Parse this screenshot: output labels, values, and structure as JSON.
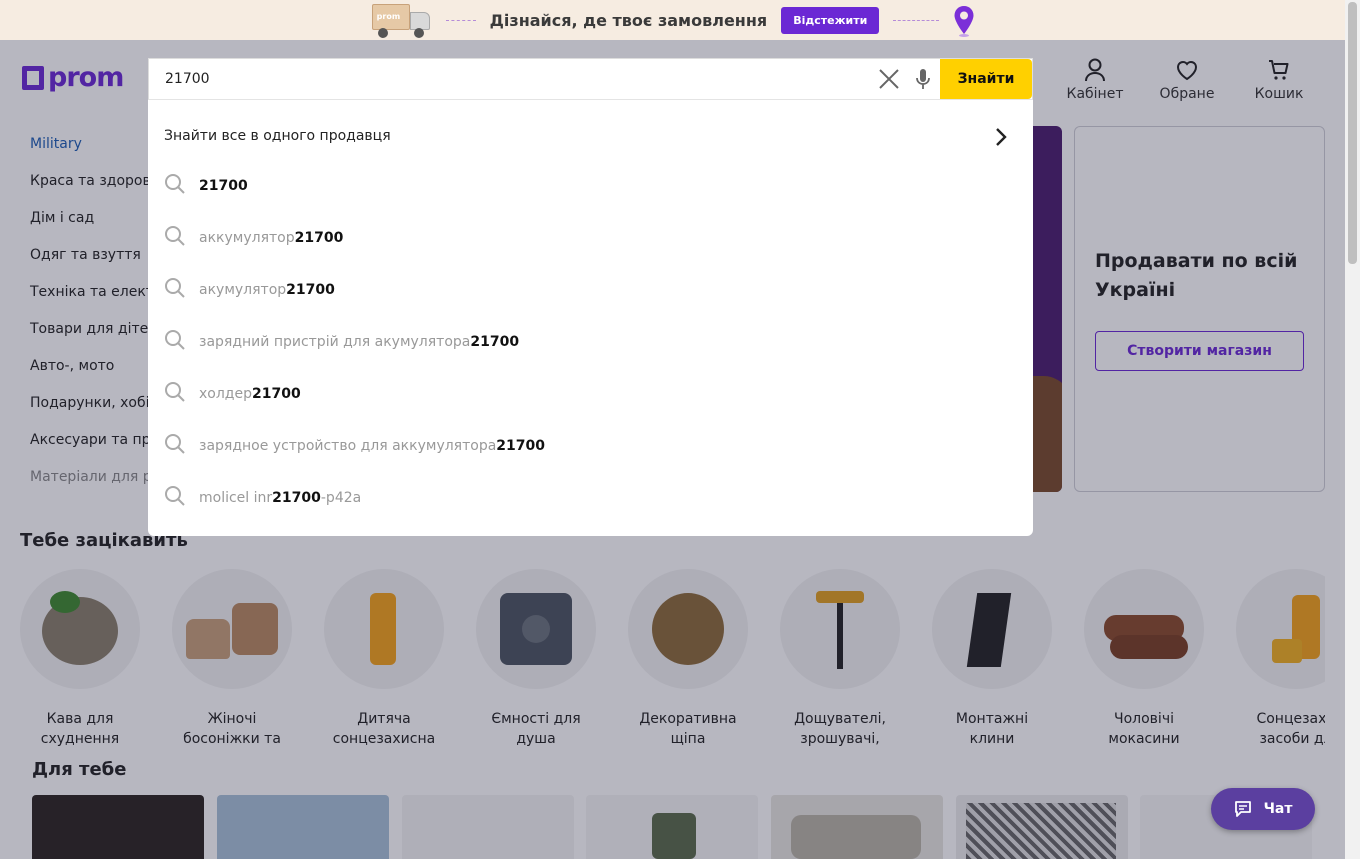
{
  "banner": {
    "truck_label": "prom",
    "text": "Дізнайся, де твоє замовлення",
    "track_button": "Відстежити"
  },
  "header": {
    "logo": "prom",
    "cabinet": "Кабінет",
    "favorites": "Обране",
    "cart": "Кошик"
  },
  "search": {
    "value": "21700",
    "button": "Знайти",
    "seller_link": "Знайти все в одного продавця",
    "suggestions": [
      {
        "pre": "",
        "hl": "21700",
        "post": ""
      },
      {
        "pre": "аккумулятор ",
        "hl": "21700",
        "post": ""
      },
      {
        "pre": "акумулятор ",
        "hl": "21700",
        "post": ""
      },
      {
        "pre": "зарядний пристрій для акумулятора ",
        "hl": "21700",
        "post": ""
      },
      {
        "pre": "холдер ",
        "hl": "21700",
        "post": ""
      },
      {
        "pre": "зарядное устройство для аккумулятора ",
        "hl": "21700",
        "post": ""
      },
      {
        "pre": "molicel inr",
        "hl": "21700",
        "post": "-p42a"
      }
    ]
  },
  "categories": [
    "Military",
    "Краса та здоров",
    "Дім і сад",
    "Одяг та взуття",
    "Техніка та елект",
    "Товари для діте",
    "Авто-, мото",
    "Подарунки, хобі",
    "Аксесуари та пр",
    "Матеріали для р"
  ],
  "sell_card": {
    "title": "Продавати по всій Україні",
    "button": "Створити магазин"
  },
  "interest": {
    "title": "Тебе зацікавить",
    "items": [
      {
        "label": "Кава для схуднення",
        "icon": "coffee-beans-icon"
      },
      {
        "label": "Жіночі босоніжки та",
        "icon": "sandal-icon"
      },
      {
        "label": "Дитяча сонцезахисна",
        "icon": "sunscreen-bottle-icon"
      },
      {
        "label": "Ємності для душа",
        "icon": "water-tank-icon"
      },
      {
        "label": "Декоративна щіпа",
        "icon": "wood-chips-icon"
      },
      {
        "label": "Дощувателі, зрошувачі,",
        "icon": "sprinkler-icon"
      },
      {
        "label": "Монтажні клини",
        "icon": "wedge-icon"
      },
      {
        "label": "Чоловічі мокасини",
        "icon": "moccasin-icon"
      },
      {
        "label": "Сонцезахи засоби дл",
        "icon": "sunscreen-icon"
      }
    ]
  },
  "for_you": {
    "title": "Для тебе"
  },
  "chat": {
    "label": "Чат"
  },
  "colors": {
    "brand": "#6b28d4",
    "find_button": "#ffd000",
    "chat": "#5b3fa0",
    "active_category": "#1d5eb4"
  }
}
